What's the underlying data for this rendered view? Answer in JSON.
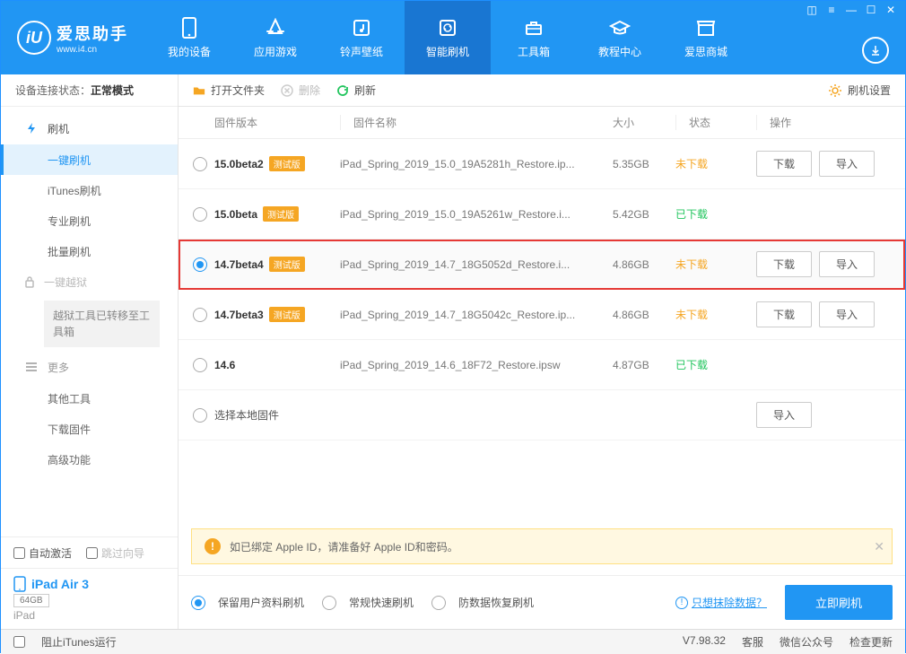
{
  "brand": {
    "name": "爱思助手",
    "url": "www.i4.cn"
  },
  "nav": [
    "我的设备",
    "应用游戏",
    "铃声壁纸",
    "智能刷机",
    "工具箱",
    "教程中心",
    "爱思商城"
  ],
  "sidebar": {
    "status_label": "设备连接状态：",
    "status_value": "正常模式",
    "flash_head": "刷机",
    "items": [
      "一键刷机",
      "iTunes刷机",
      "专业刷机",
      "批量刷机"
    ],
    "jailbreak": "一键越狱",
    "jail_note": "越狱工具已转移至工具箱",
    "more_head": "更多",
    "more_items": [
      "其他工具",
      "下载固件",
      "高级功能"
    ],
    "auto_activate": "自动激活",
    "skip_guide": "跳过向导",
    "device_name": "iPad Air 3",
    "device_storage": "64GB",
    "device_type": "iPad"
  },
  "toolbar": {
    "open": "打开文件夹",
    "delete": "删除",
    "refresh": "刷新",
    "settings": "刷机设置"
  },
  "columns": {
    "ver": "固件版本",
    "name": "固件名称",
    "size": "大小",
    "status": "状态",
    "action": "操作"
  },
  "tag": "测试版",
  "buttons": {
    "download": "下载",
    "import": "导入"
  },
  "status": {
    "not": "未下载",
    "done": "已下载"
  },
  "rows": [
    {
      "v": "15.0beta2",
      "tag": true,
      "n": "iPad_Spring_2019_15.0_19A5281h_Restore.ip...",
      "s": "5.35GB",
      "st": "not",
      "dl": true,
      "imp": true,
      "sel": false,
      "hl": false
    },
    {
      "v": "15.0beta",
      "tag": true,
      "n": "iPad_Spring_2019_15.0_19A5261w_Restore.i...",
      "s": "5.42GB",
      "st": "done",
      "dl": false,
      "imp": false,
      "sel": false,
      "hl": false
    },
    {
      "v": "14.7beta4",
      "tag": true,
      "n": "iPad_Spring_2019_14.7_18G5052d_Restore.i...",
      "s": "4.86GB",
      "st": "not",
      "dl": true,
      "imp": true,
      "sel": true,
      "hl": true
    },
    {
      "v": "14.7beta3",
      "tag": true,
      "n": "iPad_Spring_2019_14.7_18G5042c_Restore.ip...",
      "s": "4.86GB",
      "st": "not",
      "dl": true,
      "imp": true,
      "sel": false,
      "hl": false
    },
    {
      "v": "14.6",
      "tag": false,
      "n": "iPad_Spring_2019_14.6_18F72_Restore.ipsw",
      "s": "4.87GB",
      "st": "done",
      "dl": false,
      "imp": false,
      "sel": false,
      "hl": false
    }
  ],
  "local_firmware": "选择本地固件",
  "warn": "如已绑定 Apple ID，请准备好 Apple ID和密码。",
  "flash_opts": [
    "保留用户资料刷机",
    "常规快速刷机",
    "防数据恢复刷机"
  ],
  "erase_link": "只想抹除数据？",
  "flash_btn": "立即刷机",
  "statusbar": {
    "block_itunes": "阻止iTunes运行",
    "version": "V7.98.32",
    "service": "客服",
    "wechat": "微信公众号",
    "update": "检查更新"
  }
}
